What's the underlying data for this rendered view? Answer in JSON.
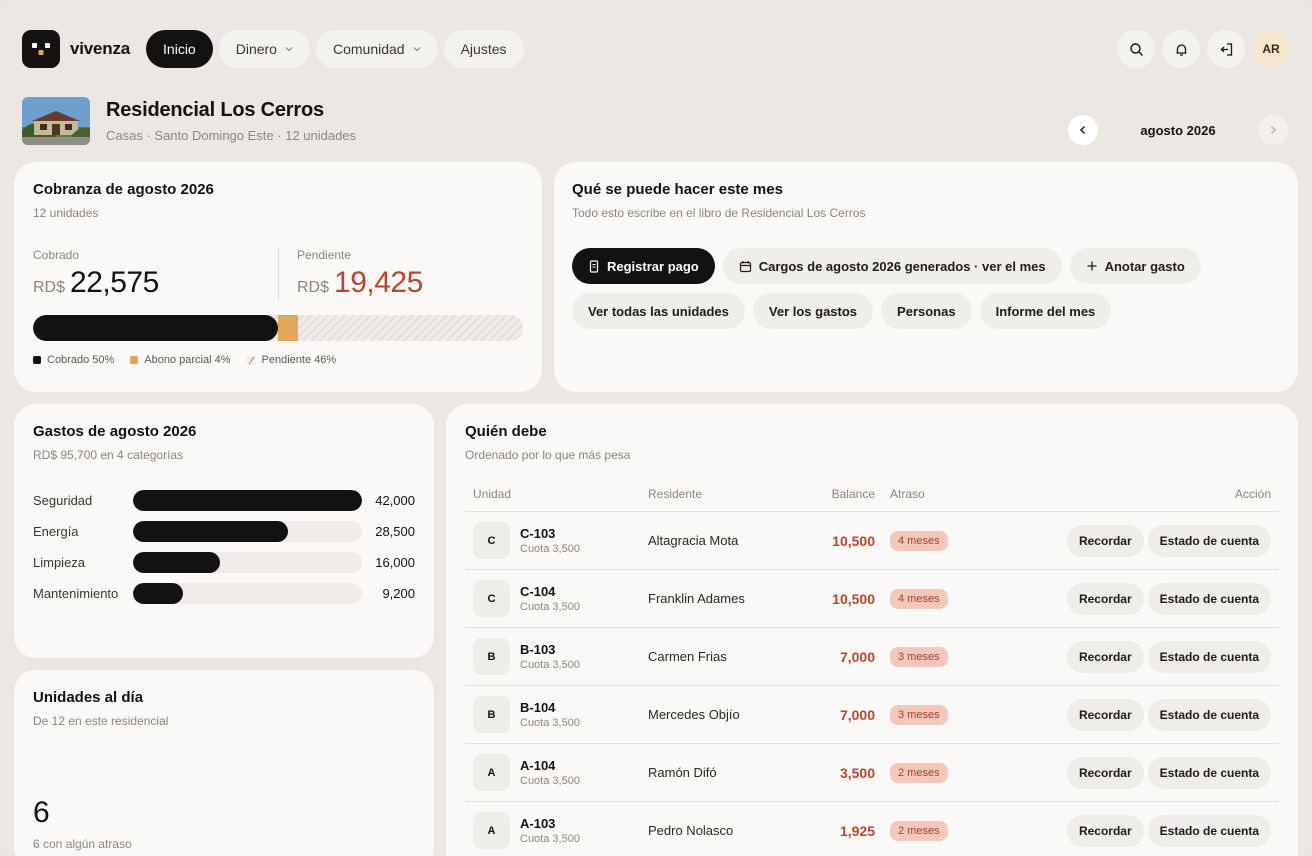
{
  "app": {
    "brand": "vivenza",
    "nav": [
      {
        "label": "Inicio",
        "active": true
      },
      {
        "label": "Dinero",
        "dropdown": true
      },
      {
        "label": "Comunidad",
        "dropdown": true
      },
      {
        "label": "Ajustes"
      }
    ],
    "avatar_initials": "AR"
  },
  "property": {
    "name": "Residencial Los Cerros",
    "subtitle": "Casas · Santo Domingo Este · 12 unidades",
    "month": "agosto 2026"
  },
  "collection": {
    "title": "Cobranza de agosto 2026",
    "subtitle": "12 unidades",
    "collected_label": "Cobrado",
    "pending_label": "Pendiente",
    "currency": "RD$",
    "collected_value": "22,575",
    "pending_value": "19,425",
    "paid_pct": 50,
    "partial_pct": 4,
    "pending_pct": 46,
    "legend": {
      "paid": "Cobrado 50%",
      "partial": "Abono parcial 4%",
      "pending": "Pendiente 46%"
    },
    "colors": {
      "paid": "#141210",
      "partial": "#e2a658",
      "pending_accent": "#b54630"
    }
  },
  "actions": {
    "title": "Qué se puede hacer este mes",
    "subtitle": "Todo esto escribe en el libro de Residencial Los Cerros",
    "items": [
      {
        "label": "Registrar pago",
        "icon": "receipt-icon",
        "primary": true
      },
      {
        "label": "Cargos de agosto 2026 generados · ver el mes",
        "icon": "calendar-icon"
      },
      {
        "label": "Anotar gasto",
        "icon": "plus-icon"
      },
      {
        "label": "Ver todas las unidades"
      },
      {
        "label": "Ver los gastos"
      },
      {
        "label": "Personas"
      },
      {
        "label": "Informe del mes"
      }
    ]
  },
  "expenses": {
    "title": "Gastos de agosto 2026",
    "subtitle": "RD$ 95,700 en 4 categorías",
    "max": 42000,
    "items": [
      {
        "label": "Seguridad",
        "value": 42000,
        "display": "42,000"
      },
      {
        "label": "Energía",
        "value": 28500,
        "display": "28,500"
      },
      {
        "label": "Limpieza",
        "value": 16000,
        "display": "16,000"
      },
      {
        "label": "Mantenimiento",
        "value": 9200,
        "display": "9,200"
      }
    ]
  },
  "up_to_date": {
    "title": "Unidades al día",
    "subtitle": "De 12 en este residencial",
    "value": "6",
    "note": "6 con algún atraso"
  },
  "debtors": {
    "title": "Quién debe",
    "subtitle": "Ordenado por lo que más pesa",
    "headers": {
      "unit": "Unidad",
      "resident": "Residente",
      "balance": "Balance",
      "late": "Atraso",
      "action": "Acción"
    },
    "remind_label": "Recordar",
    "statement_label": "Estado de cuenta",
    "rows": [
      {
        "block": "C",
        "unit": "C-103",
        "fee": "Cuota 3,500",
        "resident": "Altagracia Mota",
        "balance": "10,500",
        "late": "4 meses"
      },
      {
        "block": "C",
        "unit": "C-104",
        "fee": "Cuota 3,500",
        "resident": "Franklin Adames",
        "balance": "10,500",
        "late": "4 meses"
      },
      {
        "block": "B",
        "unit": "B-103",
        "fee": "Cuota 3,500",
        "resident": "Carmen Frias",
        "balance": "7,000",
        "late": "3 meses"
      },
      {
        "block": "B",
        "unit": "B-104",
        "fee": "Cuota 3,500",
        "resident": "Mercedes Objío",
        "balance": "7,000",
        "late": "3 meses"
      },
      {
        "block": "A",
        "unit": "A-104",
        "fee": "Cuota 3,500",
        "resident": "Ramón Difó",
        "balance": "3,500",
        "late": "2 meses"
      },
      {
        "block": "A",
        "unit": "A-103",
        "fee": "Cuota 3,500",
        "resident": "Pedro Nolasco",
        "balance": "1,925",
        "late": "2 meses"
      }
    ]
  }
}
